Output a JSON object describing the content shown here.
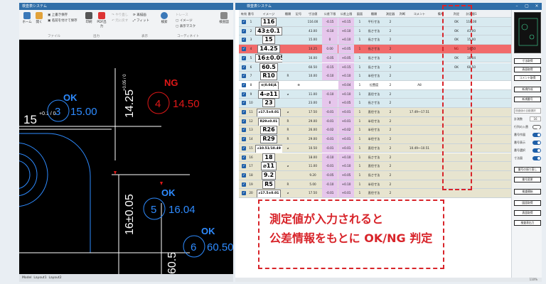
{
  "left_window": {
    "title": "検査表システム",
    "ribbon": {
      "home": "ホーム",
      "open": "開く",
      "overwrite_save": "上書き保存",
      "save_as": "名前を付けて保存",
      "print": "印刷",
      "pdf_out": "PDF出力",
      "redo": "やり直し",
      "undo": "元に戻す",
      "refresh": "再描画",
      "fit": "フィット",
      "search": "検索",
      "group_file": "ファイル",
      "group_output": "出力",
      "group_view": "表示",
      "group_coordinate": "コーディネイト",
      "image_label": "イメージ",
      "display_mask": "表示マスク",
      "trace_label": "トレース",
      "inspect_label": "検査図"
    },
    "cad": {
      "labels": [
        {
          "num": "3",
          "value": "15.00",
          "status": "OK",
          "dim": "15",
          "tol": "+0.1 / 0",
          "color": "#2e8bff"
        },
        {
          "num": "4",
          "value": "14.50",
          "status": "NG",
          "dim": "14.25",
          "tol": "+0.05 / 0",
          "color": "#e01818"
        },
        {
          "num": "5",
          "value": "16.04",
          "status": "OK",
          "dim": "16±0.05",
          "color": "#2e8bff"
        },
        {
          "num": "6",
          "value": "60.50",
          "status": "OK",
          "dim": "60.5",
          "color": "#2e8bff"
        }
      ]
    },
    "status_tabs": [
      "Model",
      "Layout1",
      "Layout2"
    ]
  },
  "right_window": {
    "title": "検査表システム",
    "columns": [
      "有効",
      "番号",
      "イメージ",
      "種類",
      "記号",
      "寸法値",
      "公差下限",
      "公差上限",
      "図面",
      "種類",
      "測定器",
      "判断",
      "コメント",
      "備考",
      "判定",
      "計測値1"
    ],
    "rows": [
      {
        "no": "1",
        "img": "116",
        "kind": "",
        "sym": "",
        "val": "116.00",
        "lo": "-0.15",
        "hi": "+0.15",
        "p": "1",
        "t": "平行寸法",
        "q": "2",
        "cm": "",
        "note": "",
        "judge": "OK",
        "meas": "116.00",
        "bg": "#d8eaf0"
      },
      {
        "no": "2",
        "img": "43±0.1",
        "kind": "",
        "sym": "",
        "val": "43.00",
        "lo": "-0.10",
        "hi": "+0.10",
        "p": "1",
        "t": "長さ寸法",
        "q": "2",
        "cm": "",
        "note": "",
        "judge": "OK",
        "meas": "43.00",
        "bg": "#d8eaf0"
      },
      {
        "no": "3",
        "img": "15",
        "kind": "",
        "sym": "",
        "val": "15.00",
        "lo": "0",
        "hi": "+0.10",
        "p": "1",
        "t": "長さ寸法",
        "q": "2",
        "cm": "",
        "note": "",
        "judge": "OK",
        "meas": "15.00",
        "bg": "#d8eaf0"
      },
      {
        "no": "4",
        "img": "14.25",
        "kind": "",
        "sym": "",
        "val": "14.25",
        "lo": "0.00",
        "hi": "+0.05",
        "p": "1",
        "t": "長さ寸法",
        "q": "2",
        "cm": "",
        "note": "",
        "judge": "NG",
        "meas": "14.50",
        "bg": "#f16a6a"
      },
      {
        "no": "5",
        "img": "16±0.05",
        "kind": "",
        "sym": "",
        "val": "16.00",
        "lo": "-0.05",
        "hi": "+0.05",
        "p": "1",
        "t": "長さ寸法",
        "q": "2",
        "cm": "",
        "note": "",
        "judge": "OK",
        "meas": "16.04",
        "bg": "#d8eaf0"
      },
      {
        "no": "6",
        "img": "60.5",
        "kind": "",
        "sym": "",
        "val": "60.50",
        "lo": "-0.15",
        "hi": "+0.15",
        "p": "1",
        "t": "長さ寸法",
        "q": "2",
        "cm": "",
        "note": "",
        "judge": "OK",
        "meas": "60.50",
        "bg": "#d8eaf0"
      },
      {
        "no": "7",
        "img": "R10",
        "kind": "R",
        "sym": "",
        "val": "10.00",
        "lo": "-0.10",
        "hi": "+0.10",
        "p": "1",
        "t": "半径寸法",
        "q": "2",
        "cm": "",
        "note": "",
        "judge": "",
        "meas": "",
        "bg": "#d8eaf0"
      },
      {
        "no": "8",
        "img": "⊕|0.04|A",
        "kind": "",
        "sym": "⊕",
        "val": "",
        "lo": "",
        "hi": "+0.04",
        "p": "1",
        "t": "位置度",
        "q": "2",
        "cm": "A8",
        "note": "",
        "judge": "",
        "meas": "",
        "bg": "#ffffff"
      },
      {
        "no": "9",
        "img": "4-⌀11",
        "kind": "⌀",
        "sym": "",
        "val": "11.00",
        "lo": "-0.10",
        "hi": "+0.10",
        "p": "1",
        "t": "直径寸法",
        "q": "2",
        "cm": "",
        "note": "",
        "judge": "",
        "meas": "",
        "bg": "#d8eaf0"
      },
      {
        "no": "10",
        "img": "23",
        "kind": "",
        "sym": "",
        "val": "23.00",
        "lo": "0",
        "hi": "+0.05",
        "p": "1",
        "t": "長さ寸法",
        "q": "2",
        "cm": "",
        "note": "",
        "judge": "",
        "meas": "",
        "bg": "#d8eaf0"
      },
      {
        "no": "11",
        "img": "⌀17.5±0.01",
        "kind": "⌀",
        "sym": "",
        "val": "17.50",
        "lo": "-0.01",
        "hi": "+0.01",
        "p": "1",
        "t": "直径寸法",
        "q": "2",
        "cm": "17.49～17.51",
        "note": "",
        "judge": "",
        "meas": "",
        "bg": "#e7e4cf"
      },
      {
        "no": "12",
        "img": "R29±0.01",
        "kind": "R",
        "sym": "",
        "val": "29.00",
        "lo": "-0.01",
        "hi": "+0.01",
        "p": "1",
        "t": "半径寸法",
        "q": "2",
        "cm": "",
        "note": "",
        "judge": "",
        "meas": "",
        "bg": "#e7e4cf"
      },
      {
        "no": "13",
        "img": "R26",
        "kind": "R",
        "sym": "",
        "val": "26.00",
        "lo": "-0.02",
        "hi": "+0.02",
        "p": "1",
        "t": "半径寸法",
        "q": "2",
        "cm": "",
        "note": "",
        "judge": "",
        "meas": "",
        "bg": "#e7e4cf"
      },
      {
        "no": "14",
        "img": "R29",
        "kind": "R",
        "sym": "",
        "val": "29.00",
        "lo": "-0.01",
        "hi": "+0.01",
        "p": "1",
        "t": "半径寸法",
        "q": "2",
        "cm": "",
        "note": "",
        "judge": "",
        "meas": "",
        "bg": "#e7e4cf"
      },
      {
        "no": "15",
        "img": "⌀10.51/10.49",
        "kind": "⌀",
        "sym": "",
        "val": "10.50",
        "lo": "-0.01",
        "hi": "+0.01",
        "p": "1",
        "t": "直径寸法",
        "q": "2",
        "cm": "10.49～10.51",
        "note": "",
        "judge": "",
        "meas": "",
        "bg": "#e7e4cf"
      },
      {
        "no": "16",
        "img": "18",
        "kind": "",
        "sym": "",
        "val": "18.00",
        "lo": "-0.10",
        "hi": "+0.10",
        "p": "1",
        "t": "長さ寸法",
        "q": "2",
        "cm": "",
        "note": "",
        "judge": "",
        "meas": "",
        "bg": "#e7e4cf"
      },
      {
        "no": "17",
        "img": "⌀11",
        "kind": "⌀",
        "sym": "",
        "val": "11.00",
        "lo": "-0.01",
        "hi": "+0.10",
        "p": "1",
        "t": "直径寸法",
        "q": "2",
        "cm": "",
        "note": "",
        "judge": "",
        "meas": "",
        "bg": "#e7e4cf"
      },
      {
        "no": "18",
        "img": "9.2",
        "kind": "",
        "sym": "",
        "val": "9.20",
        "lo": "-0.05",
        "hi": "+0.05",
        "p": "1",
        "t": "長さ寸法",
        "q": "2",
        "cm": "",
        "note": "",
        "judge": "",
        "meas": "",
        "bg": "#e7e4cf"
      },
      {
        "no": "19",
        "img": "R5",
        "kind": "R",
        "sym": "",
        "val": "5.00",
        "lo": "-0.10",
        "hi": "+0.10",
        "p": "1",
        "t": "半径寸法",
        "q": "2",
        "cm": "",
        "note": "",
        "judge": "",
        "meas": "",
        "bg": "#e7e4cf"
      },
      {
        "no": "20",
        "img": "⌀17.5±0.01",
        "kind": "⌀",
        "sym": "",
        "val": "17.50",
        "lo": "-0.01",
        "hi": "+0.01",
        "p": "1",
        "t": "直径寸法",
        "q": "2",
        "cm": "",
        "note": "",
        "judge": "",
        "meas": "",
        "bg": "#e7e4cf"
      }
    ],
    "side": {
      "btn_dim_get": "寸法取得",
      "btn_table_get": "表面取得",
      "btn_comment_get": "コメント取得",
      "btn_new": "新規作成",
      "btn_new_num": "新規番号",
      "dropdown": "検査値の自動選択",
      "count_label": "計測数",
      "count_value": "16",
      "toggles": [
        "行列の入替",
        "番号作図",
        "番号表示",
        "番号選択",
        "寸法図"
      ],
      "btn_renumber": "番号の振り直し",
      "btn_number_change": "番号変更",
      "btn_start": "検査開始",
      "btn_image_get": "図面取得",
      "btn_table_get2": "表面取得",
      "btn_output": "検査表出力",
      "zoom": "110%"
    }
  },
  "callout": {
    "line1": "測定値が入力されると",
    "line2": "公差情報をもとに OK/NG 判定"
  },
  "colors": {
    "accent": "#2f6ea8",
    "ok": "#2e8bff",
    "ng": "#e01818",
    "callout": "#d8242a"
  }
}
